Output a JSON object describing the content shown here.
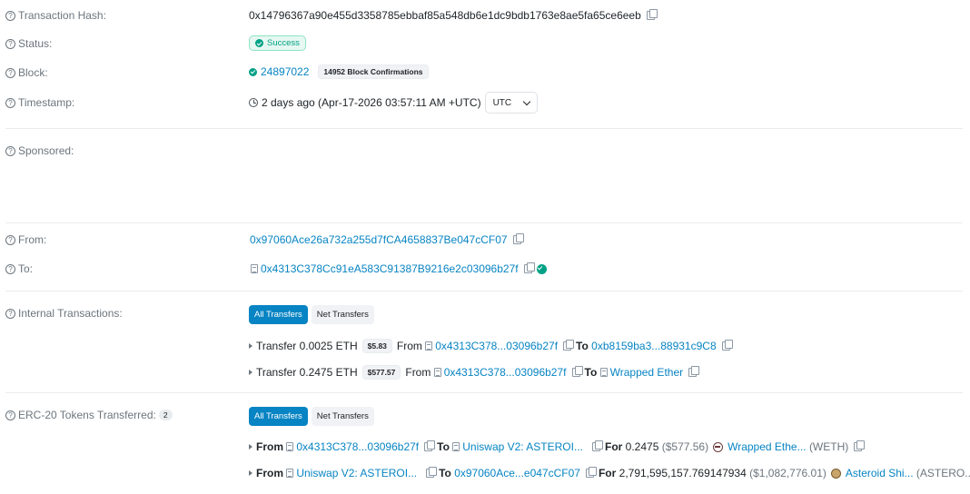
{
  "tx_hash": {
    "label": "Transaction Hash:",
    "value": "0x14796367a90e455d3358785ebbaf85a548db6e1dc9bdb1763e8ae5fa65ce6eeb"
  },
  "status": {
    "label": "Status:",
    "value": "Success"
  },
  "block": {
    "label": "Block:",
    "number": "24897022",
    "confirmations": "14952 Block Confirmations"
  },
  "timestamp": {
    "label": "Timestamp:",
    "value": "2 days ago (Apr-17-2026 03:57:11 AM +UTC)",
    "tz_selected": "UTC"
  },
  "sponsored": {
    "label": "Sponsored:"
  },
  "from": {
    "label": "From:",
    "address": "0x97060Ace26a732a255d7fCA4658837Be047cCF07"
  },
  "to": {
    "label": "To:",
    "address": "0x4313C378Cc91eA583C91387B9216e2c03096b27f"
  },
  "internal": {
    "label": "Internal Transactions:",
    "tabs": [
      "All Transfers",
      "Net Transfers"
    ],
    "rows": [
      {
        "word": "Transfer",
        "amount": "0.0025 ETH",
        "usd": "$5.83",
        "from_word": "From",
        "from": "0x4313C378...03096b27f",
        "to_word": "To",
        "to": "0xb8159ba3...88931c9C8",
        "to_is_contract": false
      },
      {
        "word": "Transfer",
        "amount": "0.2475 ETH",
        "usd": "$577.57",
        "from_word": "From",
        "from": "0x4313C378...03096b27f",
        "to_word": "To",
        "to": "Wrapped Ether",
        "to_is_contract": true
      }
    ]
  },
  "erc20": {
    "label": "ERC-20 Tokens Transferred:",
    "count": "2",
    "tabs": [
      "All Transfers",
      "Net Transfers"
    ],
    "rows": [
      {
        "from_word": "From",
        "from": "0x4313C378...03096b27f",
        "to_word": "To",
        "to": "Uniswap V2: ASTEROI...",
        "for_word": "For",
        "amount": "0.2475",
        "usd": "($577.56)",
        "token": "Wrapped Ethe...",
        "symbol": "(WETH)",
        "token_icon": "weth-icon"
      },
      {
        "from_word": "From",
        "from": "Uniswap V2: ASTEROI...",
        "to_word": "To",
        "to": "0x97060Ace...e047cCF07",
        "for_word": "For",
        "amount": "2,791,595,157.769147934",
        "usd": "($1,082,776.01)",
        "token": "Asteroid Shi...",
        "symbol": "(ASTERO...)",
        "token_icon": "asteroid-icon"
      }
    ]
  },
  "colors": {
    "link": "#0784c3",
    "success": "#00a186",
    "muted": "#6c757d"
  }
}
